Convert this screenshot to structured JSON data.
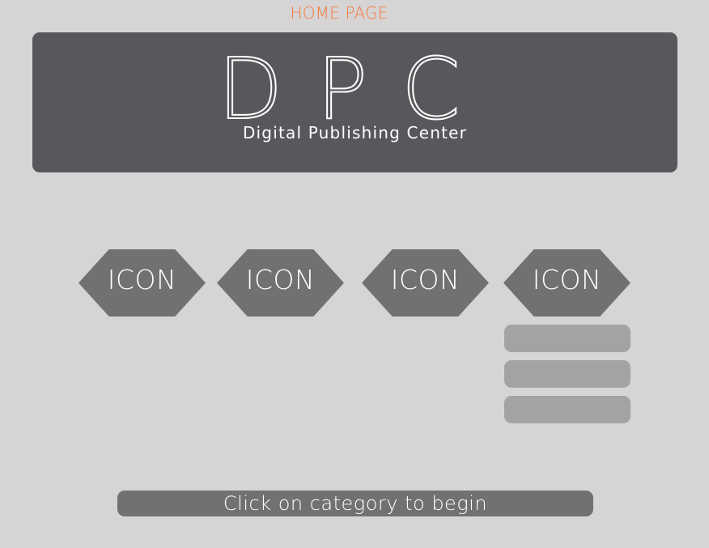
{
  "page": {
    "label": "HOME PAGE"
  },
  "banner": {
    "logo": "DPC",
    "subtitle": "Digital Publishing Center"
  },
  "categories": [
    {
      "label": "ICON"
    },
    {
      "label": "ICON"
    },
    {
      "label": "ICON"
    },
    {
      "label": "ICON"
    }
  ],
  "prompt": {
    "text": "Click on category to begin"
  },
  "colors": {
    "accent": "#f47a3a",
    "background": "#d6d4d5",
    "banner": "#57585b",
    "icon": "#717173",
    "menu_item": "#a3a2a4"
  }
}
